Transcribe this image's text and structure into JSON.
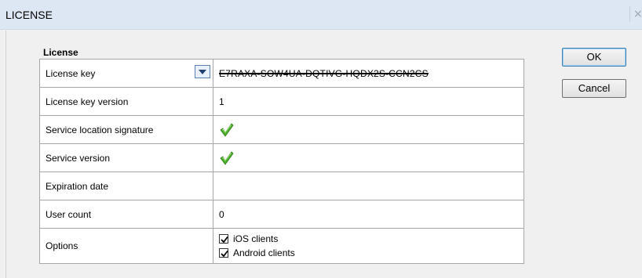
{
  "window": {
    "title": "LICENSE",
    "close_glyph": "×"
  },
  "group": {
    "label": "License"
  },
  "rows": {
    "license_key": {
      "label": "License key",
      "value": "E7RAXA-SOW4UA-DQTIVG-HQDX2S-CCN2CS"
    },
    "license_key_version": {
      "label": "License key version",
      "value": "1"
    },
    "service_location_signature": {
      "label": "Service location signature",
      "status_icon": "green-check-icon"
    },
    "service_version": {
      "label": "Service version",
      "status_icon": "green-check-icon"
    },
    "expiration_date": {
      "label": "Expiration date",
      "value": ""
    },
    "user_count": {
      "label": "User count",
      "value": "0"
    },
    "options": {
      "label": "Options",
      "ios_clients": {
        "label": "iOS clients",
        "checked": true
      },
      "android_clients": {
        "label": "Android clients",
        "checked": true
      }
    }
  },
  "buttons": {
    "ok": "OK",
    "cancel": "Cancel"
  },
  "colors": {
    "titlebar": "#dde7f3",
    "check_green": "#4caf2a",
    "dropdown_border": "#5a7fb0"
  }
}
